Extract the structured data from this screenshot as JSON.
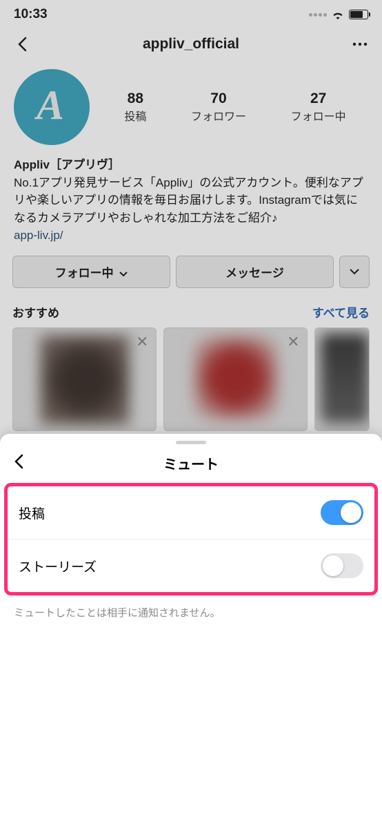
{
  "status": {
    "time": "10:33"
  },
  "header": {
    "username": "appliv_official"
  },
  "profile": {
    "avatar_letter": "A",
    "stats": {
      "posts_n": "88",
      "posts_l": "投稿",
      "followers_n": "70",
      "followers_l": "フォロワー",
      "following_n": "27",
      "following_l": "フォロー中"
    },
    "name": "Appliv［アプリヴ］",
    "bio": "No.1アプリ発見サービス「Appliv」の公式アカウント。便利なアプリや楽しいアプリの情報を毎日お届けします。Instagramでは気になるカメラアプリやおしゃれな加工方法をご紹介♪",
    "link": "app-liv.jp/"
  },
  "actions": {
    "following": "フォロー中",
    "message": "メッセージ"
  },
  "suggest": {
    "title": "おすすめ",
    "all": "すべて見る"
  },
  "sheet": {
    "title": "ミュート",
    "rows": [
      {
        "label": "投稿",
        "on": true
      },
      {
        "label": "ストーリーズ",
        "on": false
      }
    ],
    "note": "ミュートしたことは相手に通知されません。"
  }
}
